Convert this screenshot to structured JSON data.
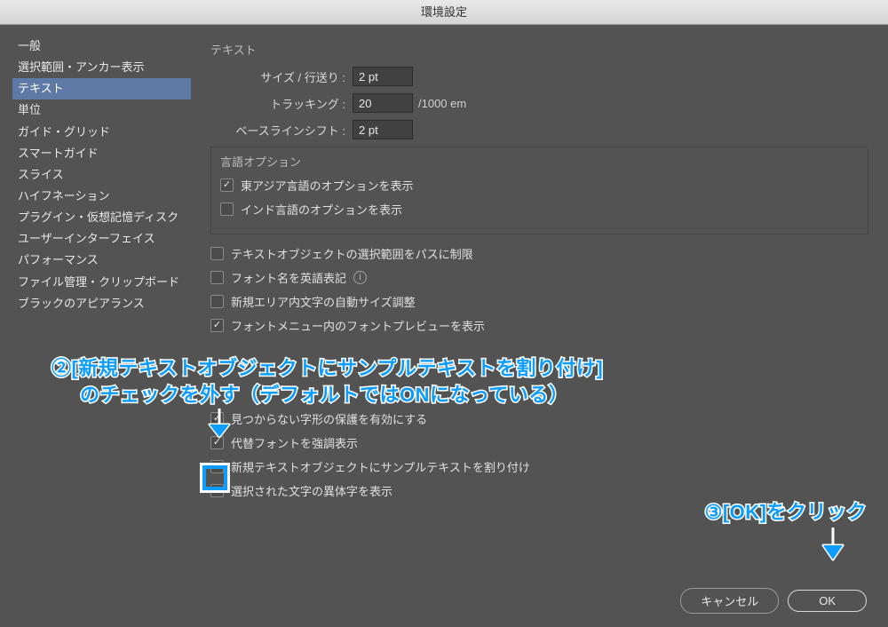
{
  "window": {
    "title": "環境設定"
  },
  "sidebar": {
    "items": [
      "一般",
      "選択範囲・アンカー表示",
      "テキスト",
      "単位",
      "ガイド・グリッド",
      "スマートガイド",
      "スライス",
      "ハイフネーション",
      "プラグイン・仮想記憶ディスク",
      "ユーザーインターフェイス",
      "パフォーマンス",
      "ファイル管理・クリップボード",
      "ブラックのアピアランス"
    ],
    "selectedIndex": 2
  },
  "main": {
    "title": "テキスト",
    "rows": {
      "sizeLeading": {
        "label": "サイズ / 行送り :",
        "value": "2 pt"
      },
      "tracking": {
        "label": "トラッキング :",
        "value": "20",
        "suffix": "/1000 em"
      },
      "baseline": {
        "label": "ベースラインシフト :",
        "value": "2 pt"
      }
    },
    "languageGroup": {
      "title": "言語オプション",
      "eastAsian": {
        "label": "東アジア言語のオプションを表示",
        "checked": true
      },
      "indic": {
        "label": "インド言語のオプションを表示",
        "checked": false
      }
    },
    "checks": {
      "limitSelectionToPath": {
        "label": "テキストオブジェクトの選択範囲をパスに制限",
        "checked": false
      },
      "englishFontNames": {
        "label": "フォント名を英語表記",
        "checked": false,
        "hasInfo": true
      },
      "autoSizeNewArea": {
        "label": "新規エリア内文字の自動サイズ調整",
        "checked": false
      },
      "fontPreviewInMenu": {
        "label": "フォントメニュー内のフォントプレビューを表示",
        "checked": true
      },
      "missingGlyphProtection": {
        "label": "見つからない字形の保護を有効にする",
        "checked": true
      },
      "highlightSubstitute": {
        "label": "代替フォントを強調表示",
        "checked": true
      },
      "fillSampleText": {
        "label": "新規テキストオブジェクトにサンプルテキストを割り付け",
        "checked": false
      },
      "showAlternateGlyphs": {
        "label": "選択された文字の異体字を表示",
        "checked": true
      }
    }
  },
  "buttons": {
    "cancel": "キャンセル",
    "ok": "OK"
  },
  "annotations": {
    "step2a": "②[新規テキストオブジェクトにサンプルテキストを割り付け]",
    "step2b": "のチェックを外す（デフォルトではONになっている）",
    "step3": "③[OK]をクリック"
  },
  "colors": {
    "accent": "#0d9cff"
  }
}
